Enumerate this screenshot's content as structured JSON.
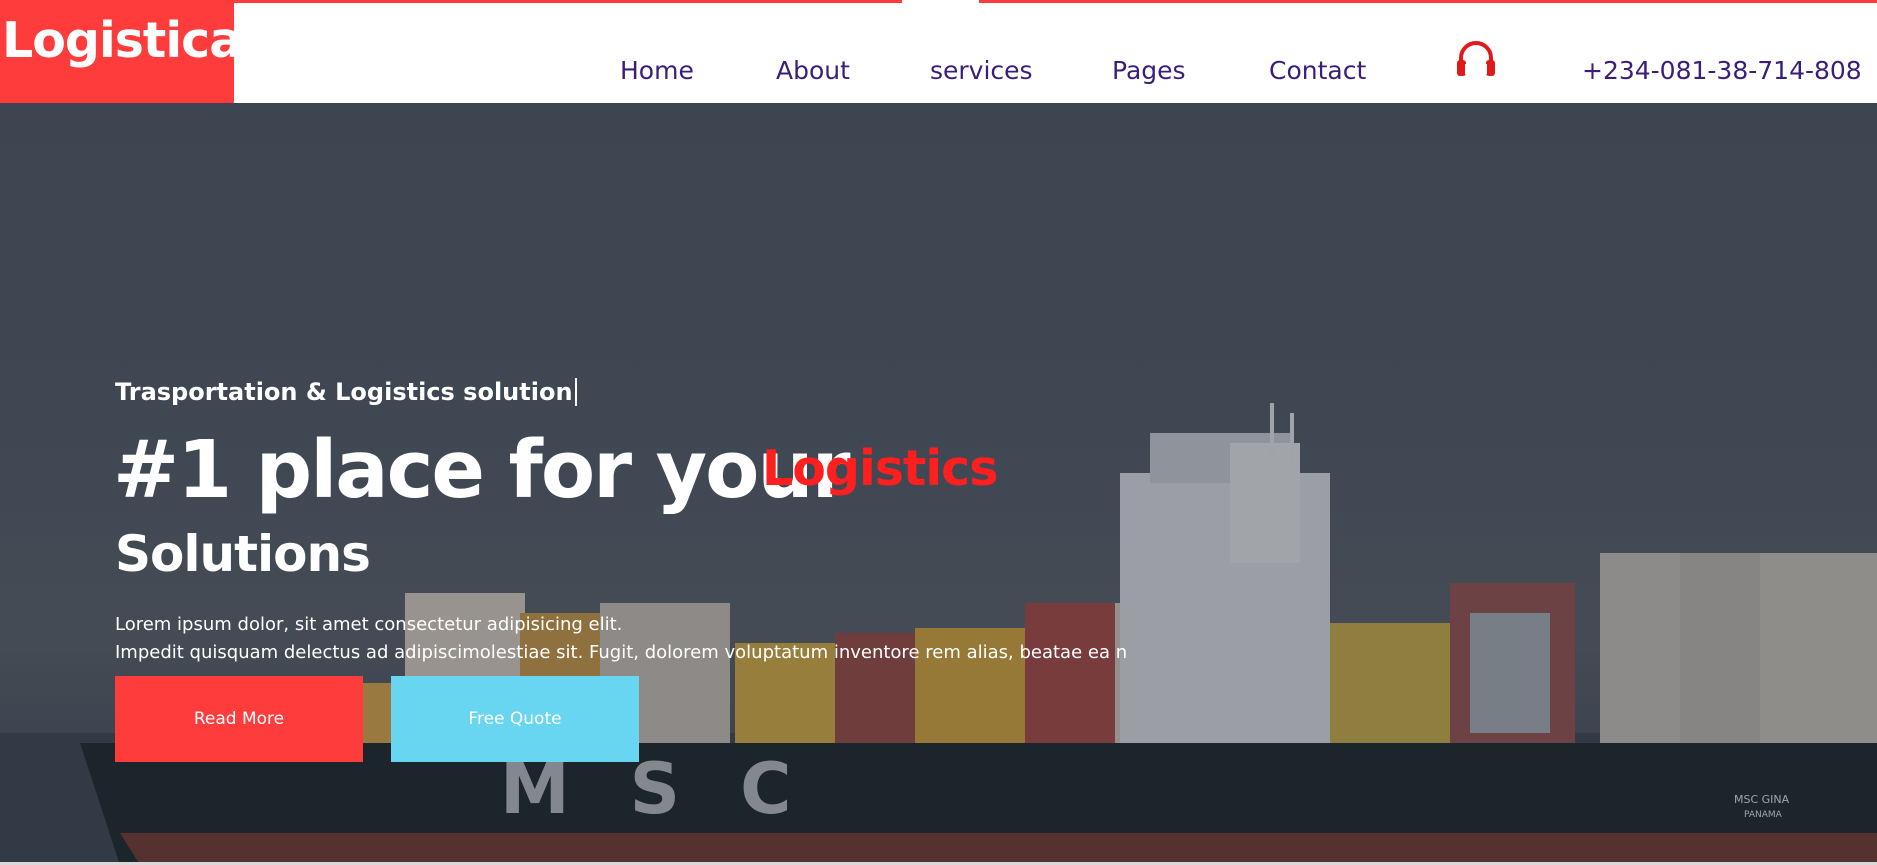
{
  "brand": {
    "logo_text": "Logistica",
    "accent_color": "#ff3c3c",
    "nav_text_color": "#3b1e79",
    "secondary_color": "#68d6f0"
  },
  "nav": {
    "items": [
      {
        "label": "Home"
      },
      {
        "label": "About"
      },
      {
        "label": "services"
      },
      {
        "label": "Pages"
      },
      {
        "label": "Contact"
      }
    ],
    "support_icon": "headset-icon",
    "phone": "+234-081-38-714-808"
  },
  "hero": {
    "tagline": "Trasportation & Logistics solution",
    "headline": "#1 place for your",
    "headline_accent": "Logistics",
    "headline_line2": "Solutions",
    "paragraph_line1": "Lorem ipsum dolor, sit amet consectetur adipisicing elit.",
    "paragraph_line2": "Impedit quisquam delectus ad adipiscimolestiae sit. Fugit, dolorem voluptatum inventore rem alias, beatae ea n",
    "background_image": "container-ship-photo",
    "ship_hull_text": "MSC",
    "ship_name": "MSC GINA",
    "ship_port": "PANAMA",
    "buttons": {
      "read_more": "Read More",
      "free_quote": "Free Quote"
    }
  }
}
